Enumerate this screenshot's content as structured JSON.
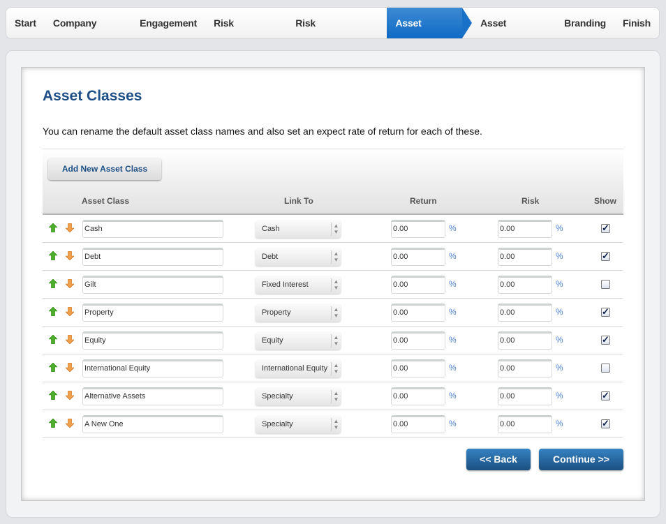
{
  "nav": {
    "items": [
      "Start",
      "Company Details",
      "Engagement",
      "Risk Categories",
      "Risk Questionnaires",
      "Asset Classes",
      "Asset Allocation",
      "Branding",
      "Finish"
    ],
    "active_index": 5
  },
  "page": {
    "title": "Asset Classes",
    "description": "You can rename the default asset class names and also set an expect rate of return for each of these.",
    "add_button": "Add New Asset Class"
  },
  "table": {
    "headers": {
      "asset_class": "Asset Class",
      "link_to": "Link To",
      "return": "Return",
      "risk": "Risk",
      "show": "Show"
    },
    "percent_symbol": "%",
    "rows": [
      {
        "name": "Cash",
        "link": "Cash",
        "return": "0.00",
        "risk": "0.00",
        "show": true
      },
      {
        "name": "Debt",
        "link": "Debt",
        "return": "0.00",
        "risk": "0.00",
        "show": true
      },
      {
        "name": "Gilt",
        "link": "Fixed Interest",
        "return": "0.00",
        "risk": "0.00",
        "show": false
      },
      {
        "name": "Property",
        "link": "Property",
        "return": "0.00",
        "risk": "0.00",
        "show": true
      },
      {
        "name": "Equity",
        "link": "Equity",
        "return": "0.00",
        "risk": "0.00",
        "show": true
      },
      {
        "name": "International Equity",
        "link": "International Equity",
        "return": "0.00",
        "risk": "0.00",
        "show": false
      },
      {
        "name": "Alternative Assets",
        "link": "Specialty",
        "return": "0.00",
        "risk": "0.00",
        "show": true
      },
      {
        "name": "A New One",
        "link": "Specialty",
        "return": "0.00",
        "risk": "0.00",
        "show": true
      }
    ]
  },
  "buttons": {
    "back": "<< Back",
    "continue": "Continue >>"
  },
  "colors": {
    "accent": "#1a72c8",
    "title": "#1d4f86",
    "up_arrow": "#4caf2a",
    "down_arrow": "#e8862a"
  }
}
